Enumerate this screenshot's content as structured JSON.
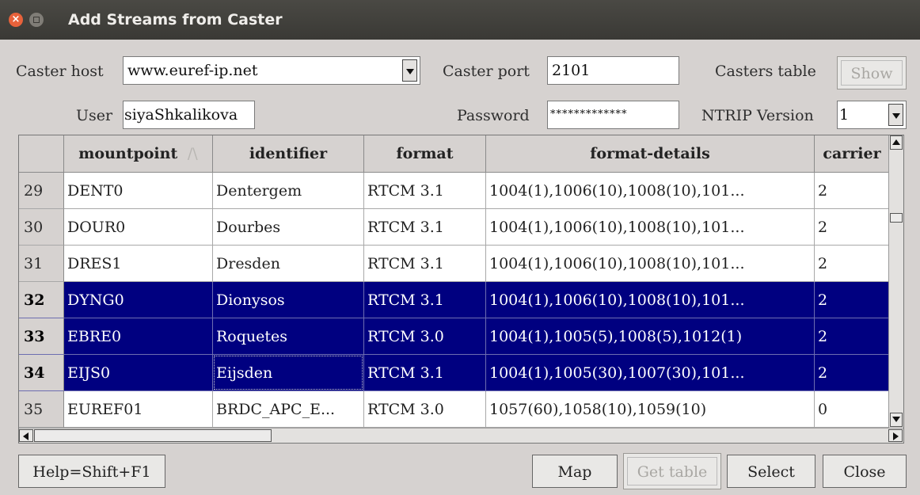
{
  "window": {
    "title": "Add Streams from Caster"
  },
  "form": {
    "caster_host_label": "Caster host",
    "caster_host_value": "www.euref-ip.net",
    "caster_port_label": "Caster port",
    "caster_port_value": "2101",
    "casters_table_label": "Casters table",
    "show_label": "Show",
    "user_label": "User",
    "user_value": "siyaShkalikova",
    "password_label": "Password",
    "password_value": "*************",
    "ntrip_version_label": "NTRIP Version",
    "ntrip_version_value": "1"
  },
  "table": {
    "columns": [
      "mountpoint",
      "identifier",
      "format",
      "format-details",
      "carrier"
    ],
    "sort_indicator": "/\\",
    "rows": [
      {
        "num": "29",
        "cells": [
          "DENT0",
          "Dentergem",
          "RTCM 3.1",
          "1004(1),1006(10),1008(10),101...",
          "2"
        ],
        "selected": false
      },
      {
        "num": "30",
        "cells": [
          "DOUR0",
          "Dourbes",
          "RTCM 3.1",
          "1004(1),1006(10),1008(10),101...",
          "2"
        ],
        "selected": false
      },
      {
        "num": "31",
        "cells": [
          "DRES1",
          "Dresden",
          "RTCM 3.1",
          "1004(1),1006(10),1008(10),101...",
          "2"
        ],
        "selected": false
      },
      {
        "num": "32",
        "cells": [
          "DYNG0",
          "Dionysos",
          "RTCM 3.1",
          "1004(1),1006(10),1008(10),101...",
          "2"
        ],
        "selected": true
      },
      {
        "num": "33",
        "cells": [
          "EBRE0",
          "Roquetes",
          "RTCM 3.0",
          "1004(1),1005(5),1008(5),1012(1)",
          "2"
        ],
        "selected": true
      },
      {
        "num": "34",
        "cells": [
          "EIJS0",
          "Eijsden",
          "RTCM 3.1",
          "1004(1),1005(30),1007(30),101...",
          "2"
        ],
        "selected": true
      },
      {
        "num": "35",
        "cells": [
          "EUREF01",
          "BRDC_APC_E...",
          "RTCM 3.0",
          "1057(60),1058(10),1059(10)",
          "0"
        ],
        "selected": false
      }
    ]
  },
  "buttons": {
    "help": "Help=Shift+F1",
    "map": "Map",
    "get_table": "Get table",
    "select": "Select",
    "close": "Close"
  },
  "colors": {
    "selection": "#000080",
    "titlebar": "#3c3b37",
    "window_bg": "#d6d2d0"
  }
}
